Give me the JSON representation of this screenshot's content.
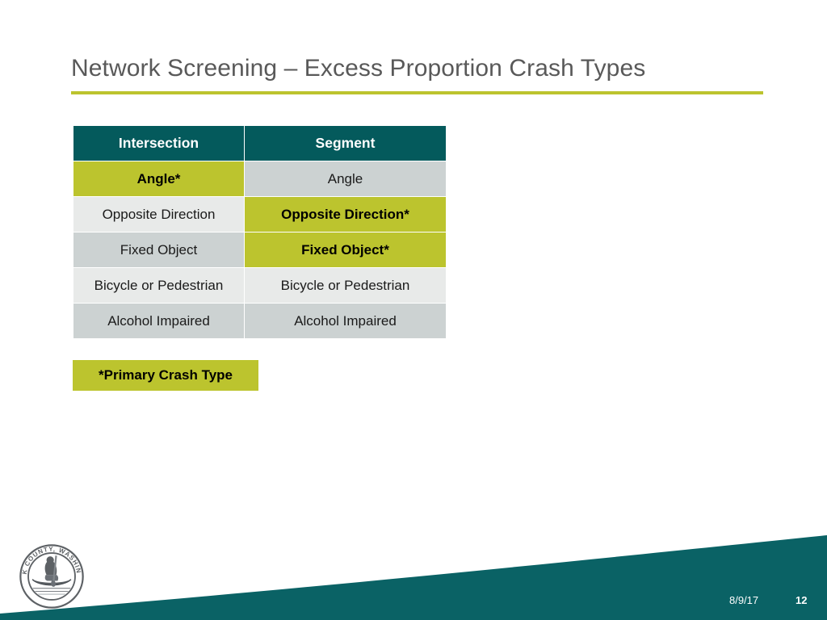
{
  "slide": {
    "title": "Network Screening – Excess Proportion Crash Types",
    "colors": {
      "teal": "#045A5C",
      "olive": "#BCC42E",
      "gray_light": "#E8EAE9",
      "gray_dark": "#CCD2D2",
      "title_text": "#595959"
    }
  },
  "table": {
    "headers": [
      "Intersection",
      "Segment"
    ],
    "rows": [
      {
        "intersection": {
          "label": "Angle*",
          "highlight": true
        },
        "segment": {
          "label": "Angle",
          "highlight": false
        }
      },
      {
        "intersection": {
          "label": "Opposite Direction",
          "highlight": false
        },
        "segment": {
          "label": "Opposite Direction*",
          "highlight": true
        }
      },
      {
        "intersection": {
          "label": "Fixed Object",
          "highlight": false
        },
        "segment": {
          "label": "Fixed Object*",
          "highlight": true
        }
      },
      {
        "intersection": {
          "label": "Bicycle or Pedestrian",
          "highlight": false
        },
        "segment": {
          "label": "Bicycle or Pedestrian",
          "highlight": false
        }
      },
      {
        "intersection": {
          "label": "Alcohol Impaired",
          "highlight": false
        },
        "segment": {
          "label": "Alcohol Impaired",
          "highlight": false
        }
      }
    ]
  },
  "legend": {
    "label": "*Primary Crash Type"
  },
  "logo": {
    "text_top": "CLARK COUNTY,",
    "text_bottom": "WASHINGTON",
    "full_text": "CLARK COUNTY, WASHINGTON"
  },
  "footer": {
    "date": "8/9/17",
    "slide_number": "12"
  }
}
